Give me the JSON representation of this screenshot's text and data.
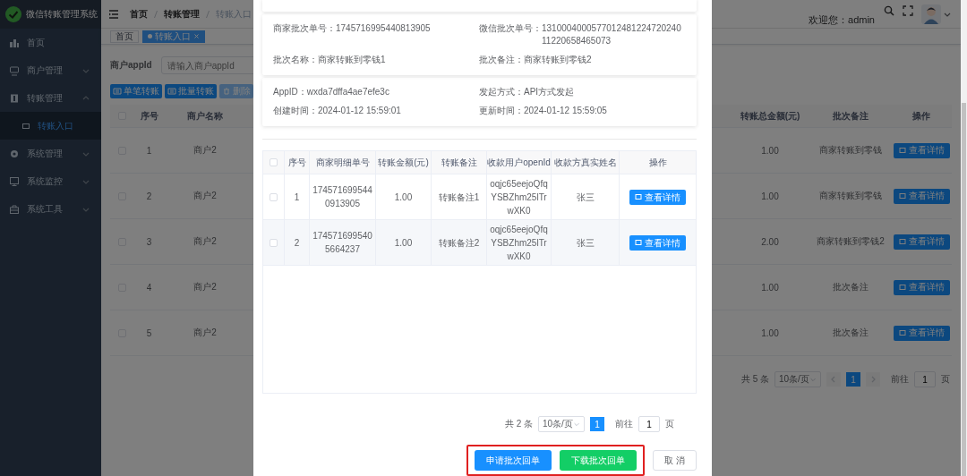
{
  "sidebar": {
    "title": "微信转账管理系统",
    "items": [
      {
        "label": "首页",
        "kind": "link",
        "selected": false
      },
      {
        "label": "商户管理",
        "kind": "submenu",
        "expanded": false
      },
      {
        "label": "转账管理",
        "kind": "submenu",
        "expanded": true,
        "children": [
          {
            "label": "转账入口",
            "selected": true
          }
        ]
      },
      {
        "label": "系统管理",
        "kind": "submenu",
        "expanded": false
      },
      {
        "label": "系统监控",
        "kind": "submenu",
        "expanded": false
      },
      {
        "label": "系统工具",
        "kind": "submenu",
        "expanded": false
      }
    ]
  },
  "header": {
    "breadcrumb": [
      "首页",
      "转账管理",
      "转账入口"
    ],
    "welcome": "欢迎您：admin"
  },
  "tags": [
    {
      "label": "首页",
      "selected": false
    },
    {
      "label": "转账入口",
      "selected": true
    }
  ],
  "search": {
    "label": "商户appId",
    "placeholder": "请输入商户appId"
  },
  "toolbar": [
    {
      "label": "单笔转账",
      "disabled": false
    },
    {
      "label": "批量转账",
      "disabled": false
    },
    {
      "label": "删除",
      "disabled": true
    }
  ],
  "table": {
    "header_checked": false,
    "columns": [
      "序号",
      "商户名称",
      "转账总金额(元)",
      "批次备注",
      "操作"
    ],
    "rows": [
      {
        "checked": false,
        "index": "1",
        "merchant": "商户2",
        "total": "1.00",
        "remark": "商家转账到零钱",
        "action": "查看详情"
      },
      {
        "checked": false,
        "index": "2",
        "merchant": "商户2",
        "total": "1.00",
        "remark": "商家转账到零钱",
        "action": "查看详情"
      },
      {
        "checked": false,
        "index": "3",
        "merchant": "商户2",
        "total": "2.00",
        "remark": "商家转账到零钱2",
        "action": "查看详情"
      },
      {
        "checked": false,
        "index": "4",
        "merchant": "商户2",
        "total": "1.00",
        "remark": "批次备注",
        "action": "查看详情"
      },
      {
        "checked": false,
        "index": "5",
        "merchant": "商户2",
        "total": "1.00",
        "remark": "批次备注",
        "action": "查看详情"
      }
    ]
  },
  "pagination": {
    "total": "共 5 条",
    "page_size": "10条/页",
    "pages": [
      {
        "label": "1",
        "selected": true
      }
    ],
    "goto_label": "前往",
    "goto_value": "1",
    "goto_suffix": "页"
  },
  "dialog": {
    "info_cards": [
      {
        "fields": [
          {
            "label": "商家批次单号：",
            "value": "1745716995440813905"
          },
          {
            "label": "微信批次单号：",
            "value": "131000400057701248122472024011220658465073"
          },
          {
            "label": "批次名称：",
            "value": "商家转账到零钱1"
          },
          {
            "label": "批次备注：",
            "value": "商家转账到零钱2"
          }
        ]
      },
      {
        "fields": [
          {
            "label": "AppID：",
            "value": "wxda7dffa4ae7efe3c"
          },
          {
            "label": "发起方式：",
            "value": "API方式发起"
          },
          {
            "label": "创建时间：",
            "value": "2024-01-12 15:59:01"
          },
          {
            "label": "更新时间：",
            "value": "2024-01-12 15:59:05"
          }
        ]
      }
    ],
    "table": {
      "header_checked": false,
      "columns": [
        "序号",
        "商家明细单号",
        "转账金额(元)",
        "转账备注",
        "收款用户openId",
        "收款方真实姓名",
        "操作"
      ],
      "rows": [
        {
          "checked": false,
          "index": "1",
          "detail_no": "1745716995440913905",
          "amount": "1.00",
          "remark": "转账备注1",
          "openid": "oqjc65eejoQfqYSBZhm25lTrwXK0",
          "name": "张三",
          "action": "查看详情"
        },
        {
          "checked": false,
          "index": "2",
          "detail_no": "1745716995405664237",
          "amount": "1.00",
          "remark": "转账备注2",
          "openid": "oqjc65eejoQfqYSBZhm25lTrwXK0",
          "name": "张三",
          "action": "查看详情"
        }
      ]
    },
    "pagination": {
      "total": "共 2 条",
      "page_size": "10条/页",
      "pages": [
        {
          "label": "1",
          "selected": true
        }
      ],
      "goto_label": "前往",
      "goto_value": "1",
      "goto_suffix": "页"
    },
    "buttons": [
      {
        "kind": "highlight_group",
        "buttons": [
          {
            "label": "申请批次回单",
            "kind": "primary"
          },
          {
            "label": "下载批次回单",
            "kind": "success"
          }
        ]
      },
      {
        "label": "取 消",
        "kind": "default"
      }
    ]
  }
}
